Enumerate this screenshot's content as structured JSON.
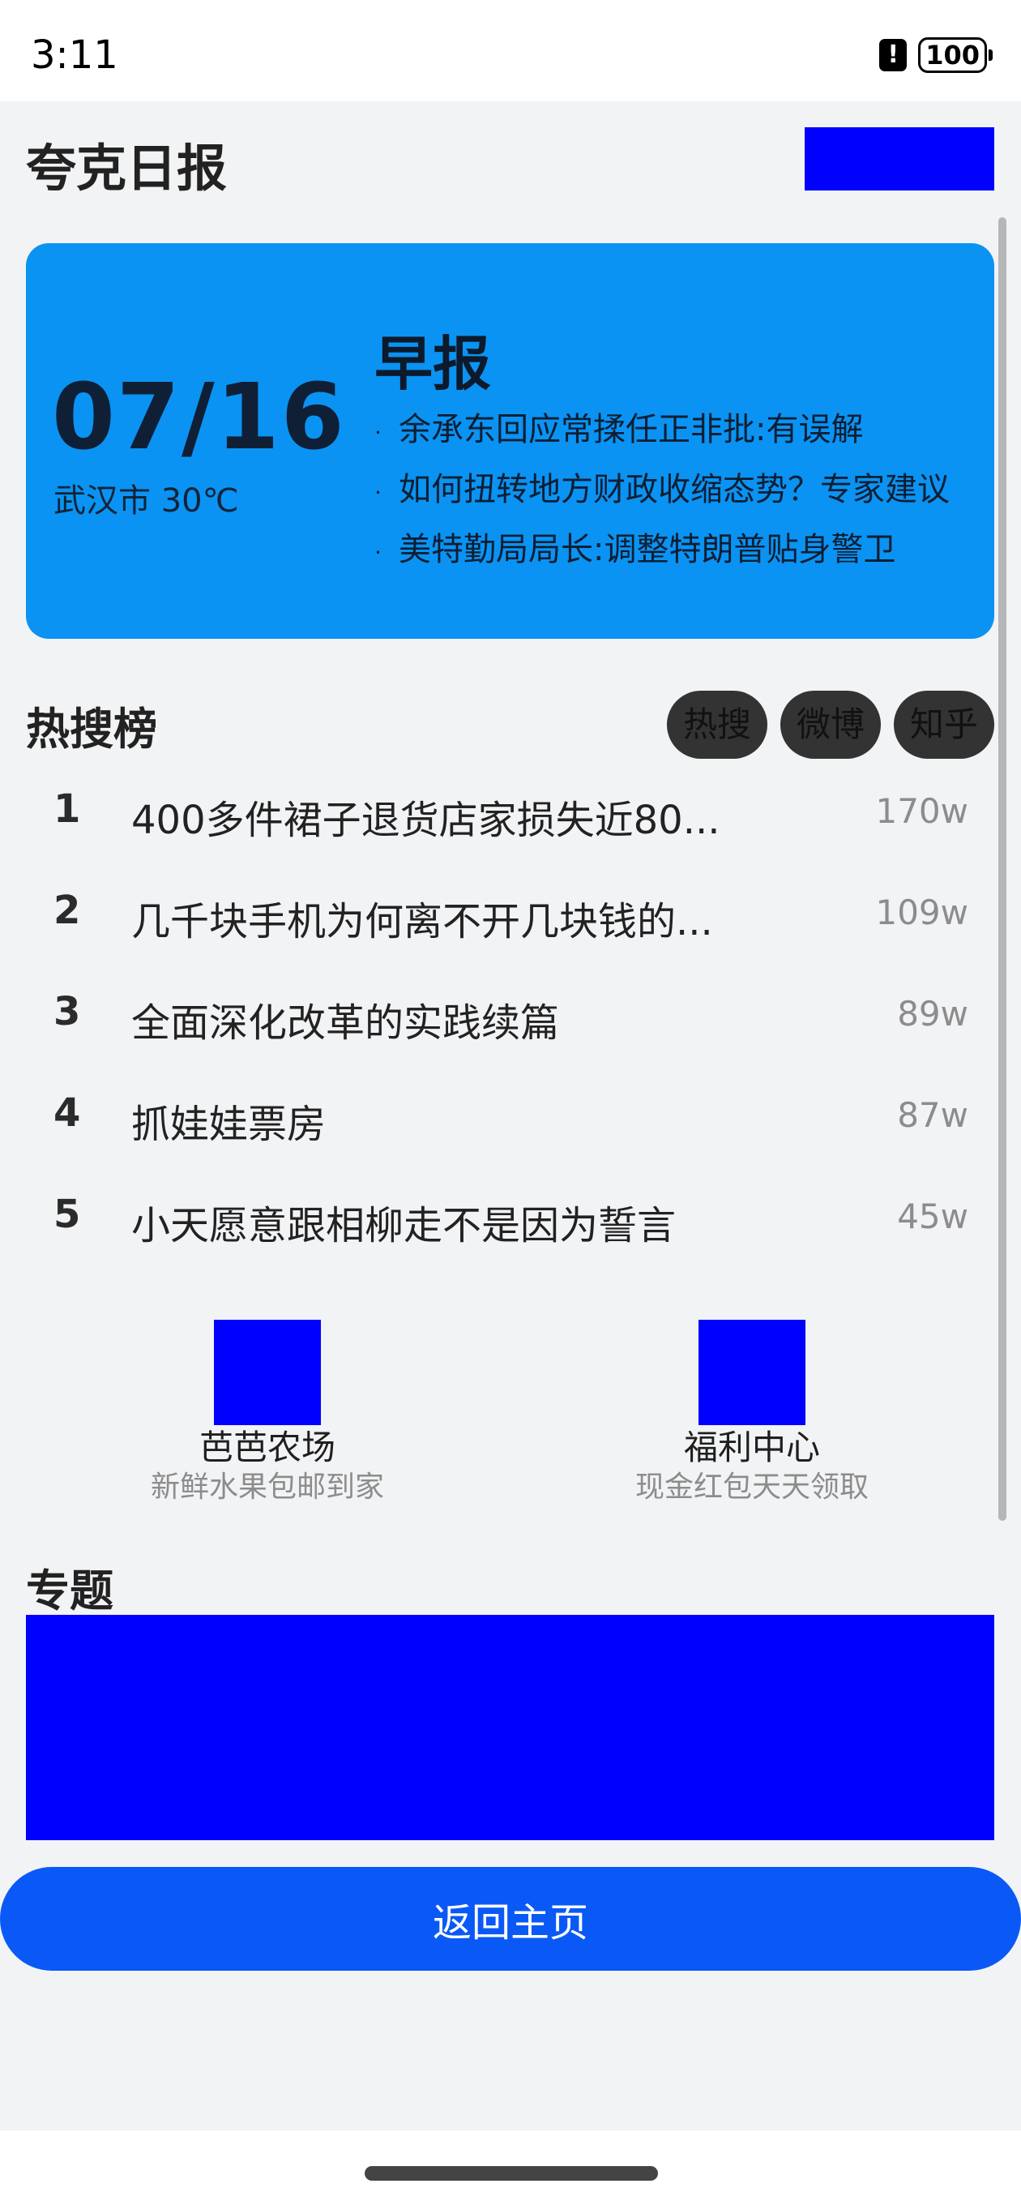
{
  "status_bar": {
    "time": "3:11",
    "alert_icon": "!",
    "battery": "100"
  },
  "header": {
    "title": "夸克日报"
  },
  "morning_card": {
    "date": "07/16",
    "weather": "武汉市 30℃",
    "heading": "早报",
    "news": [
      "余承东回应常揉任正非批:有误解",
      "如何扭转地方财政收缩态势？专家建议",
      "美特勤局局长:调整特朗普贴身警卫"
    ]
  },
  "hot_search": {
    "title": "热搜榜",
    "tabs": [
      "热搜",
      "微博",
      "知乎"
    ],
    "items": [
      {
        "rank": "1",
        "text": "400多件裙子退货店家损失近80...",
        "count": "170w"
      },
      {
        "rank": "2",
        "text": "几千块手机为何离不开几块钱的...",
        "count": "109w"
      },
      {
        "rank": "3",
        "text": "全面深化改革的实践续篇",
        "count": "89w"
      },
      {
        "rank": "4",
        "text": "抓娃娃票房",
        "count": "87w"
      },
      {
        "rank": "5",
        "text": "小天愿意跟相柳走不是因为誓言",
        "count": "45w"
      }
    ]
  },
  "promos": [
    {
      "title": "芭芭农场",
      "subtitle": "新鲜水果包邮到家"
    },
    {
      "title": "福利中心",
      "subtitle": "现金红包天天领取"
    }
  ],
  "topics": {
    "title": "专题"
  },
  "home_button": "返回主页",
  "colors": {
    "card_bg": "#0a93f2",
    "accent_button": "#0a59f7",
    "placeholder_block": "#0000ff",
    "tab_bg": "#333333"
  }
}
